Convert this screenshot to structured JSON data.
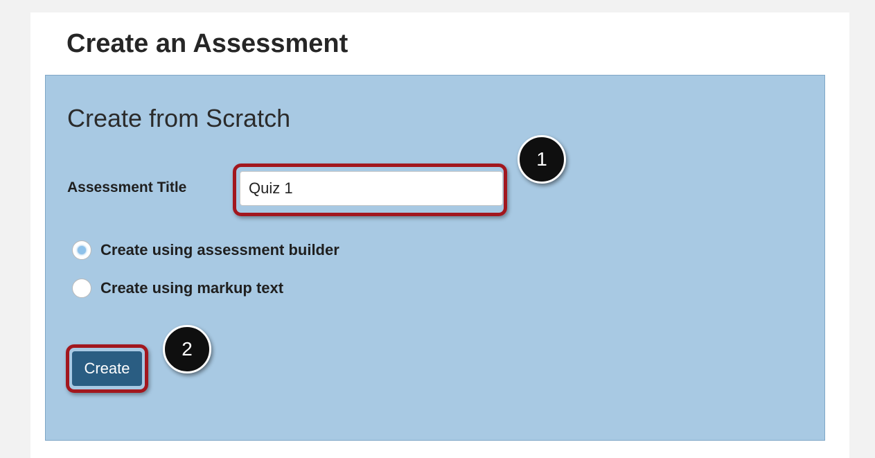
{
  "page": {
    "title": "Create an Assessment"
  },
  "panel": {
    "title": "Create from Scratch",
    "assessment_title_label": "Assessment Title",
    "assessment_title_value": "Quiz 1",
    "options": [
      {
        "label": "Create using assessment builder",
        "selected": true
      },
      {
        "label": "Create using markup text",
        "selected": false
      }
    ],
    "create_button_label": "Create"
  },
  "callouts": {
    "step_1": "1",
    "step_2": "2"
  },
  "colors": {
    "panel_background": "#a8c9e3",
    "button_background": "#2a5d82",
    "highlight_border": "#a2171e",
    "callout_background": "#0f0f0f"
  }
}
